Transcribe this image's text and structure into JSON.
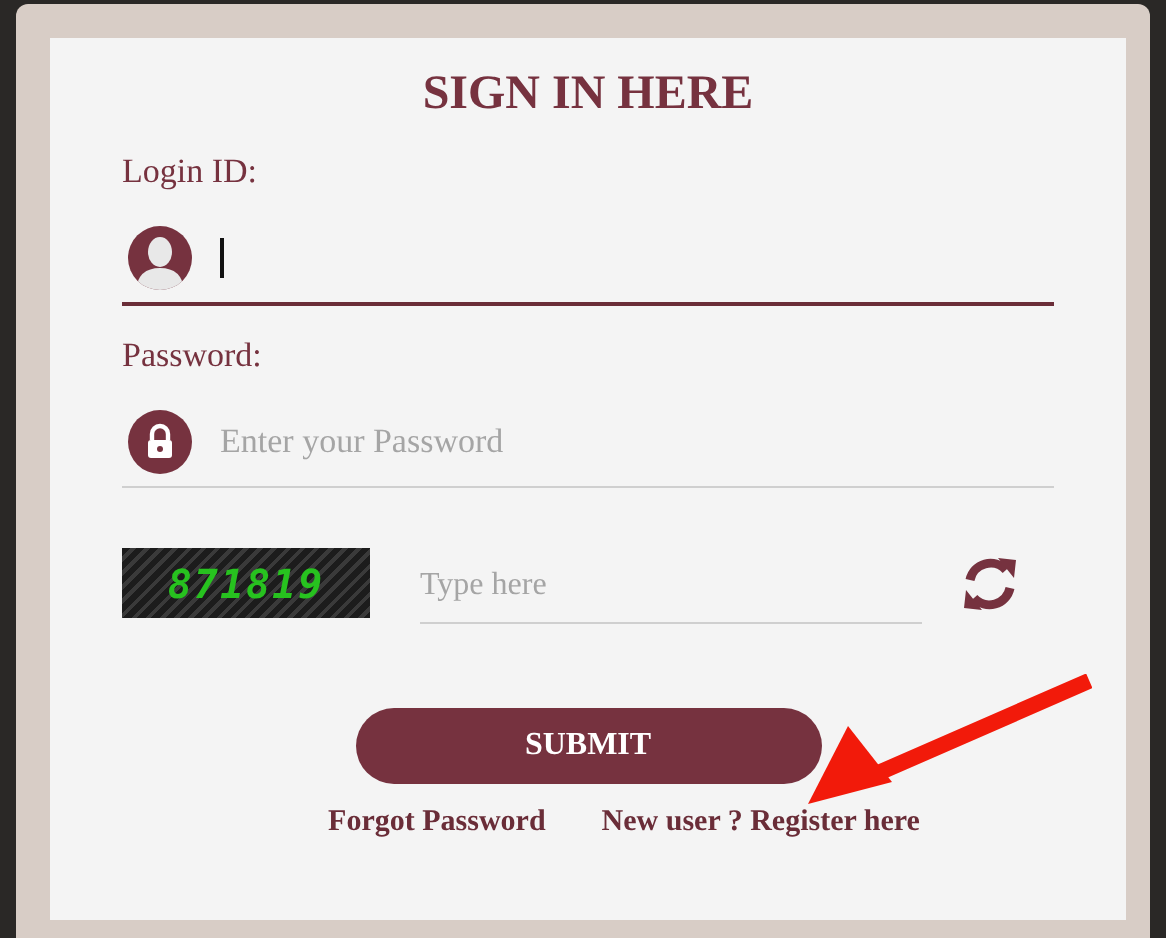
{
  "title": "SIGN IN HERE",
  "fields": [
    {
      "kind": "login",
      "label": "Login ID:",
      "focused": true
    },
    {
      "kind": "password",
      "label": "Password:",
      "placeholder": "Enter your Password",
      "focused": false
    }
  ],
  "captcha": {
    "code": "871819",
    "placeholder": "Type here"
  },
  "submit": "SUBMIT",
  "links": [
    "Forgot Password",
    "New user ? Register here"
  ]
}
